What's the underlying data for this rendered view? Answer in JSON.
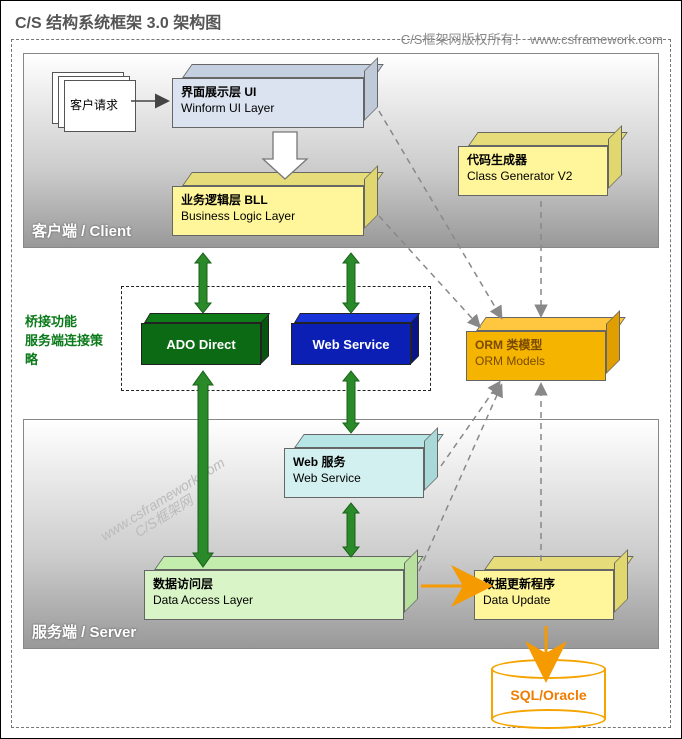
{
  "title": "C/S 结构系统框架 3.0 架构图",
  "copyright": "C/S框架网版权所有！ www.csframework.com",
  "sections": {
    "client_label": "客户端 / Client",
    "server_label": "服务端 / Server"
  },
  "client": {
    "request_doc": "客户请求",
    "ui_layer_cn": "界面展示层 UI",
    "ui_layer_en": "Winform UI Layer",
    "bll_cn": "业务逻辑层 BLL",
    "bll_en": "Business Logic Layer",
    "codegen_cn": "代码生成器",
    "codegen_en": "Class Generator V2"
  },
  "bridge": {
    "label_line1": "桥接功能",
    "label_line2": "服务端连接策略",
    "ado": "ADO Direct",
    "ws": "Web Service",
    "orm_cn": "ORM 类模型",
    "orm_en": "ORM Models"
  },
  "server": {
    "web_cn": "Web 服务",
    "web_en": "Web Service",
    "dal_cn": "数据访问层",
    "dal_en": "Data Access Layer",
    "upd_cn": "数据更新程序",
    "upd_en": "Data Update",
    "db": "SQL/Oracle"
  },
  "watermarks": {
    "w1": "www.csframework.com",
    "w2": "C/S框架网"
  },
  "colors": {
    "ui_box": "#dbe3f0",
    "bll_box": "#fff59a",
    "codegen_box": "#fff59a",
    "ado_box": "#0b6a13",
    "ws_box": "#0b1fb5",
    "orm_box": "#f5b400",
    "web_box": "#d3f0f0",
    "dal_box": "#d9f5c7",
    "upd_box": "#fff59a",
    "accent_orange": "#f59a00"
  }
}
